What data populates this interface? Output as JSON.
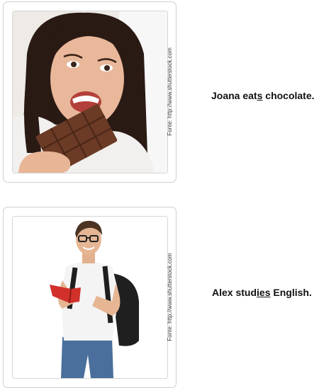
{
  "cards": [
    {
      "image_subject": "woman biting a chocolate bar",
      "credit": "Fonte: http://www.shutterstock.com",
      "sentence": {
        "before": "Joana eat",
        "underlined": "s",
        "after": " chocolate."
      }
    },
    {
      "image_subject": "student with backpack reading a red book",
      "credit": "Fonte: http://www.shutterstock.com",
      "sentence": {
        "before": "Alex stud",
        "underlined": "ies",
        "after": " English."
      }
    }
  ]
}
